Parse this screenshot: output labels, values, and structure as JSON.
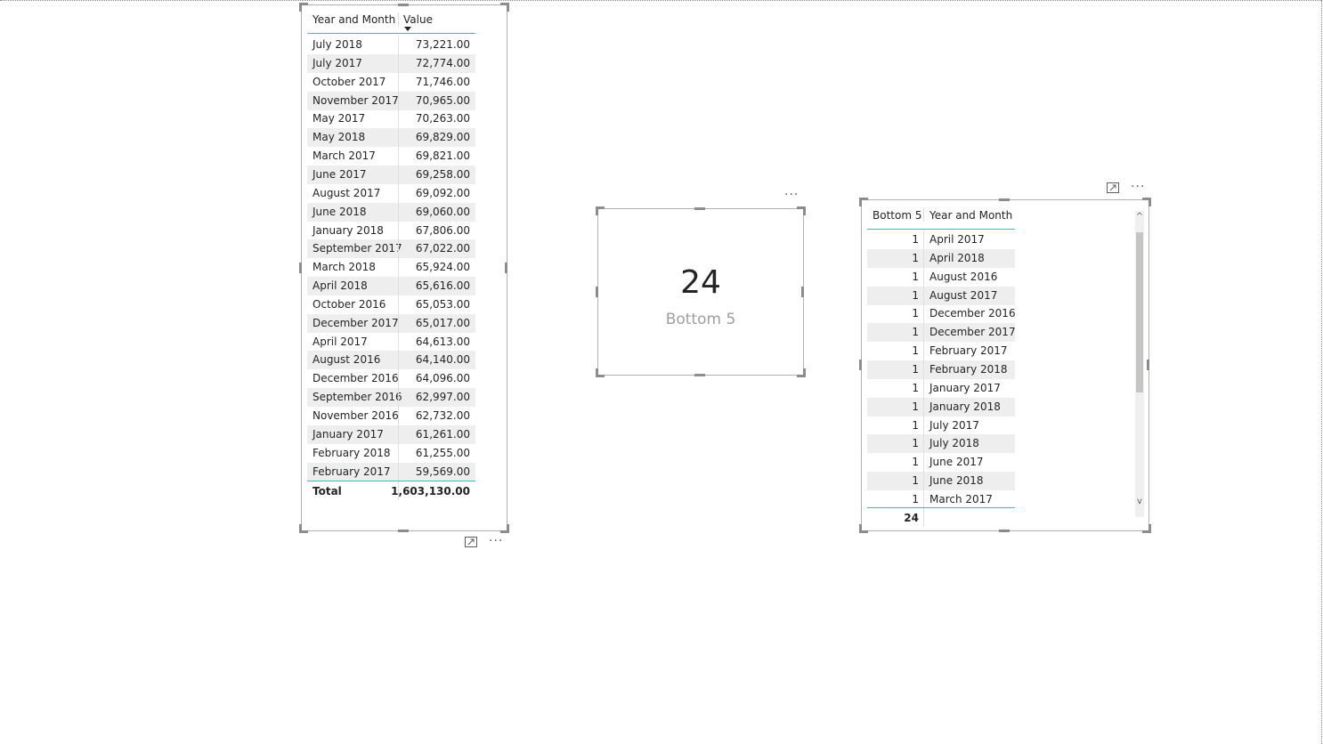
{
  "table1": {
    "headers": [
      "Year and Month",
      "Value"
    ],
    "rows": [
      [
        "July 2018",
        "73,221.00"
      ],
      [
        "July 2017",
        "72,774.00"
      ],
      [
        "October 2017",
        "71,746.00"
      ],
      [
        "November 2017",
        "70,965.00"
      ],
      [
        "May 2017",
        "70,263.00"
      ],
      [
        "May 2018",
        "69,829.00"
      ],
      [
        "March 2017",
        "69,821.00"
      ],
      [
        "June 2017",
        "69,258.00"
      ],
      [
        "August 2017",
        "69,092.00"
      ],
      [
        "June 2018",
        "69,060.00"
      ],
      [
        "January 2018",
        "67,806.00"
      ],
      [
        "September 2017",
        "67,022.00"
      ],
      [
        "March 2018",
        "65,924.00"
      ],
      [
        "April 2018",
        "65,616.00"
      ],
      [
        "October 2016",
        "65,053.00"
      ],
      [
        "December 2017",
        "65,017.00"
      ],
      [
        "April 2017",
        "64,613.00"
      ],
      [
        "August 2016",
        "64,140.00"
      ],
      [
        "December 2016",
        "64,096.00"
      ],
      [
        "September 2016",
        "62,997.00"
      ],
      [
        "November 2016",
        "62,732.00"
      ],
      [
        "January 2017",
        "61,261.00"
      ],
      [
        "February 2018",
        "61,255.00"
      ],
      [
        "February 2017",
        "59,569.00"
      ]
    ],
    "total_label": "Total",
    "total_value": "1,603,130.00"
  },
  "card": {
    "value": "24",
    "label": "Bottom 5"
  },
  "table2": {
    "headers": [
      "Bottom 5",
      "Year and Month"
    ],
    "rows": [
      [
        "1",
        "April 2017"
      ],
      [
        "1",
        "April 2018"
      ],
      [
        "1",
        "August 2016"
      ],
      [
        "1",
        "August 2017"
      ],
      [
        "1",
        "December 2016"
      ],
      [
        "1",
        "December 2017"
      ],
      [
        "1",
        "February 2017"
      ],
      [
        "1",
        "February 2018"
      ],
      [
        "1",
        "January 2017"
      ],
      [
        "1",
        "January 2018"
      ],
      [
        "1",
        "July 2017"
      ],
      [
        "1",
        "July 2018"
      ],
      [
        "1",
        "June 2017"
      ],
      [
        "1",
        "June 2018"
      ],
      [
        "1",
        "March 2017"
      ]
    ],
    "total_value": "24"
  },
  "ui": {
    "more_options": "···",
    "scroll_up": "^",
    "scroll_down": "v"
  },
  "colors": {
    "accent": "#2ec4b6",
    "alt_row": "#eeeeee",
    "handle": "#8c8c8c"
  }
}
